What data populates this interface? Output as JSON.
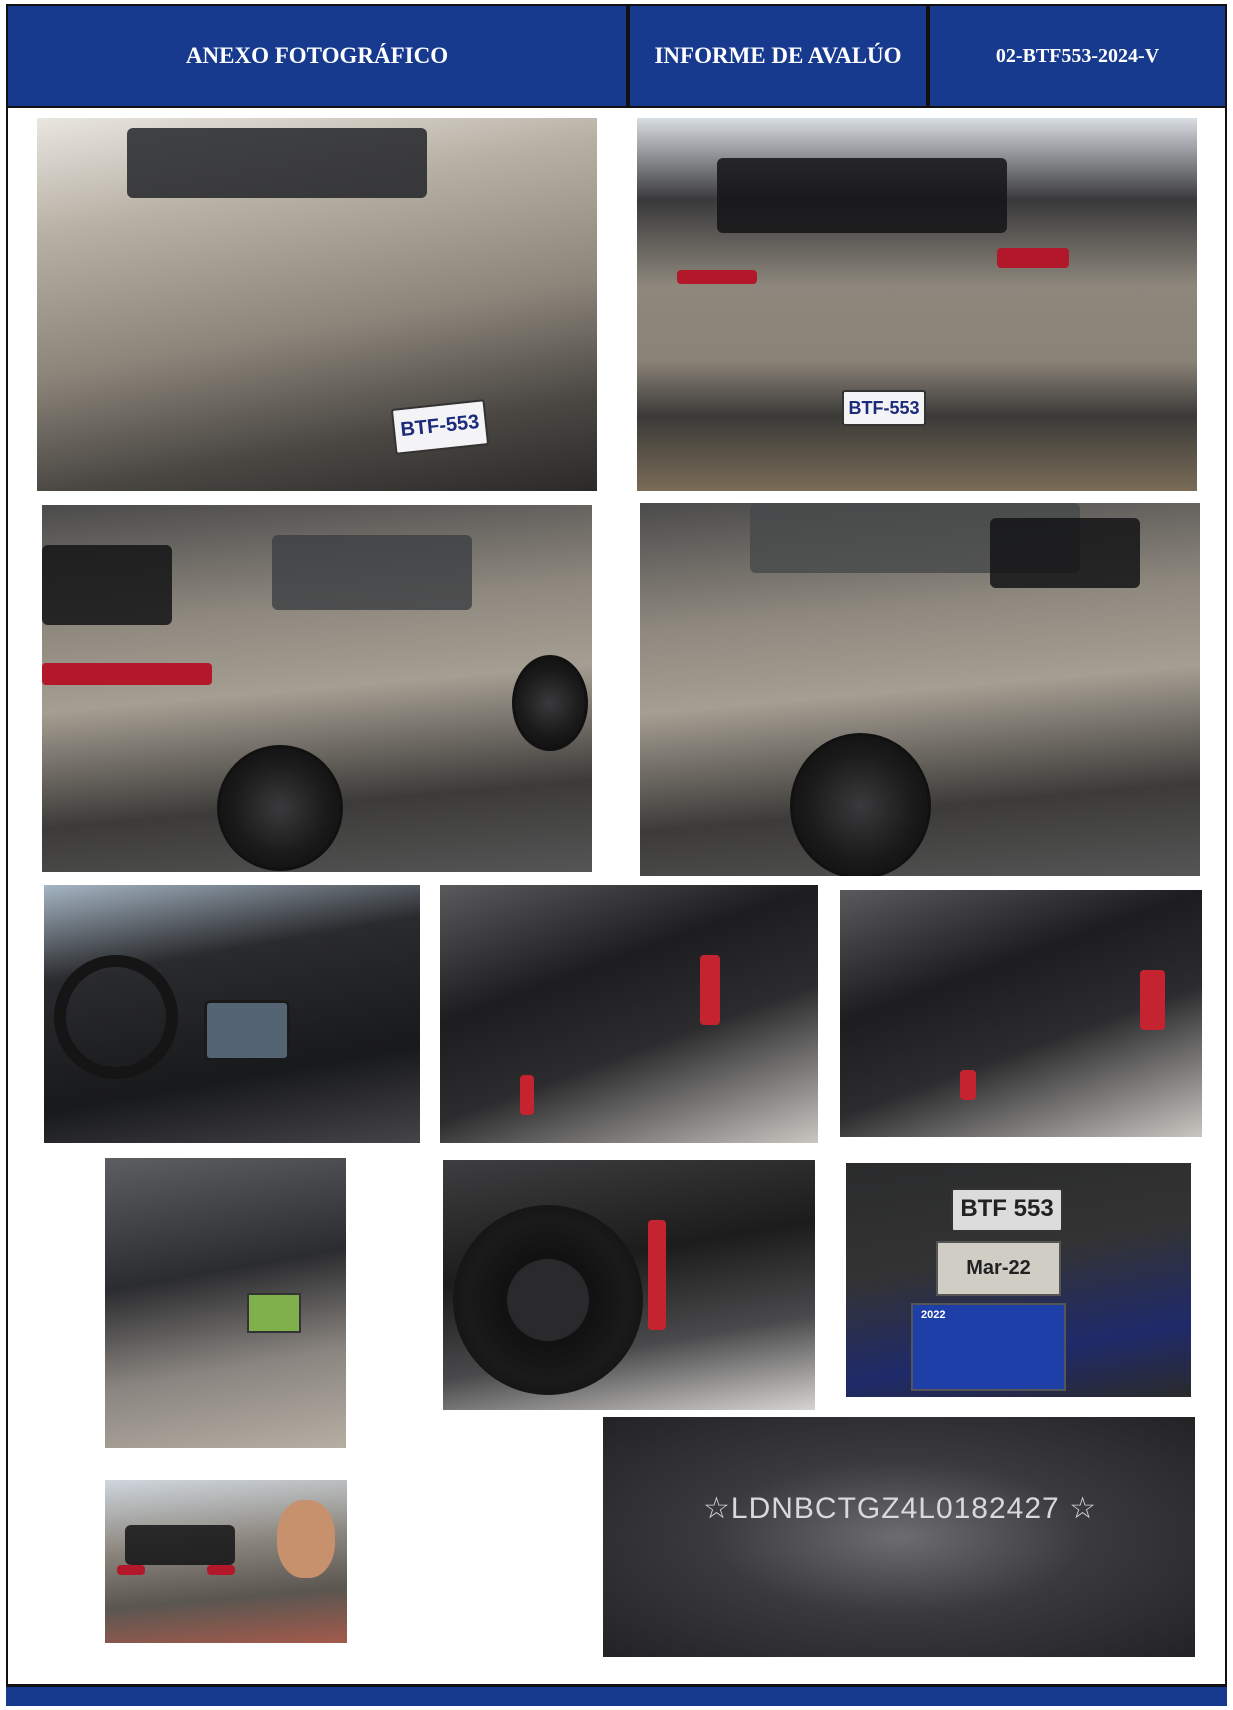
{
  "header": {
    "section_title": "ANEXO FOTOGRÁFICO",
    "report_title": "INFORME DE AVALÚO",
    "report_code": "02-BTF553-2024-V"
  },
  "photos": {
    "front": {
      "plate": "BTF-553"
    },
    "rear": {
      "plate": "BTF-553"
    },
    "windshield": {
      "plate_sticker": "BTF 553",
      "inspection_sticker": "Mar-22",
      "year_sticker": "2022"
    },
    "vin": {
      "text": "☆LDNBCTGZ4L0182427 ☆"
    }
  }
}
